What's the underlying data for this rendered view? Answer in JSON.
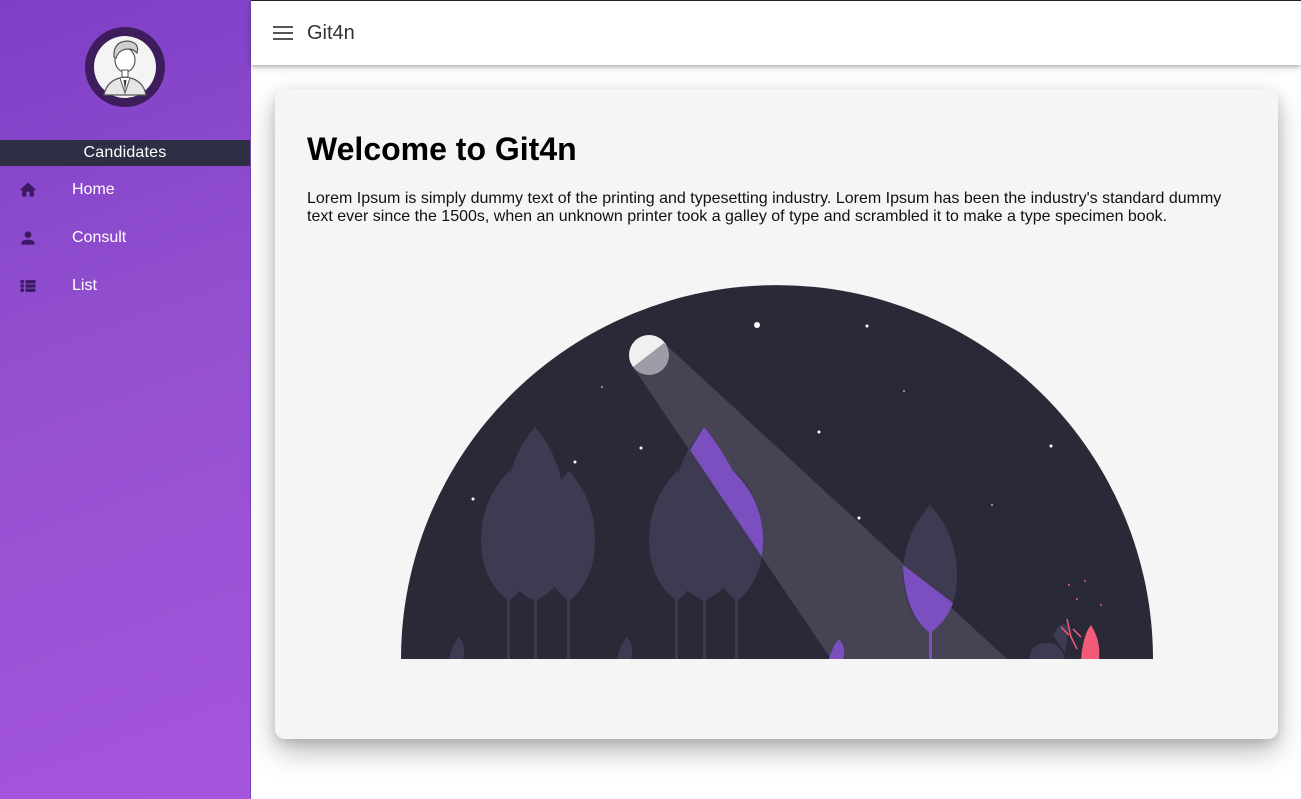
{
  "sidebar": {
    "section_title": "Candidates",
    "items": [
      {
        "label": "Home",
        "icon": "home-icon"
      },
      {
        "label": "Consult",
        "icon": "person-icon"
      },
      {
        "label": "List",
        "icon": "list-icon"
      }
    ]
  },
  "topbar": {
    "title": "Git4n",
    "menu_icon": "menu-icon"
  },
  "main": {
    "heading": "Welcome to Git4n",
    "body": "Lorem Ipsum is simply dummy text of the printing and typesetting industry. Lorem Ipsum has been the industry's standard dummy text ever since the 1500s, when an unknown printer took a galley of type and scrambled it to make a type specimen book.",
    "illustration": "night-forest-illustration"
  },
  "colors": {
    "sidebar_gradient_start": "#7e3fc6",
    "sidebar_gradient_end": "#a555dd",
    "sidebar_header": "#2e2f44",
    "card_background": "#f5f5f5",
    "night_sky": "#2a2938",
    "accent_purple": "#7b4fc0",
    "fire": "#f25a78"
  }
}
